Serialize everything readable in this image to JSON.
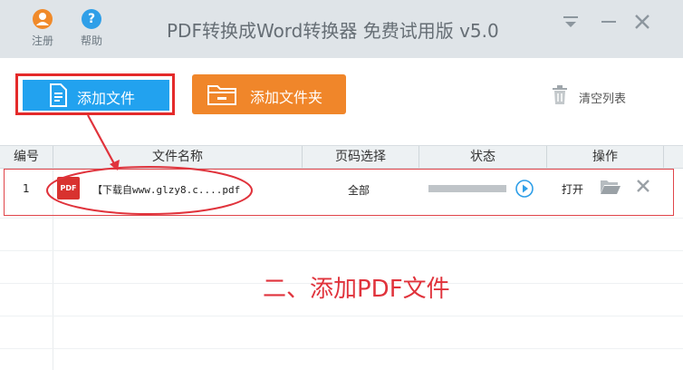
{
  "app": {
    "title": "PDF转换成Word转换器 免费试用版 v5.0",
    "register_label": "注册",
    "help_label": "帮助"
  },
  "toolbar": {
    "add_file_label": "添加文件",
    "add_folder_label": "添加文件夹",
    "clear_list_label": "清空列表"
  },
  "table": {
    "columns": [
      "编号",
      "文件名称",
      "页码选择",
      "状态",
      "操作"
    ],
    "rows": [
      {
        "index": "1",
        "file_name": "【下载自www.glzy8.c....pdf",
        "page_selection": "全部",
        "progress": 0,
        "action_open": "打开"
      }
    ]
  },
  "annotation": {
    "caption": "二、添加PDF文件"
  },
  "colors": {
    "title_bar": "#dfe4e8",
    "add_file_button": "#22a2ef",
    "add_folder_button": "#f0862a",
    "annotation_red": "#e0333c",
    "pdf_badge": "#d8322f"
  },
  "icons": {
    "register": "user-icon",
    "help": "question-icon",
    "add_file": "document-icon",
    "add_folder": "folder-icon",
    "clear": "trash-icon",
    "play": "play-icon",
    "open_folder": "folder-open-icon",
    "delete": "close-icon",
    "file_type": "pdf-icon"
  }
}
